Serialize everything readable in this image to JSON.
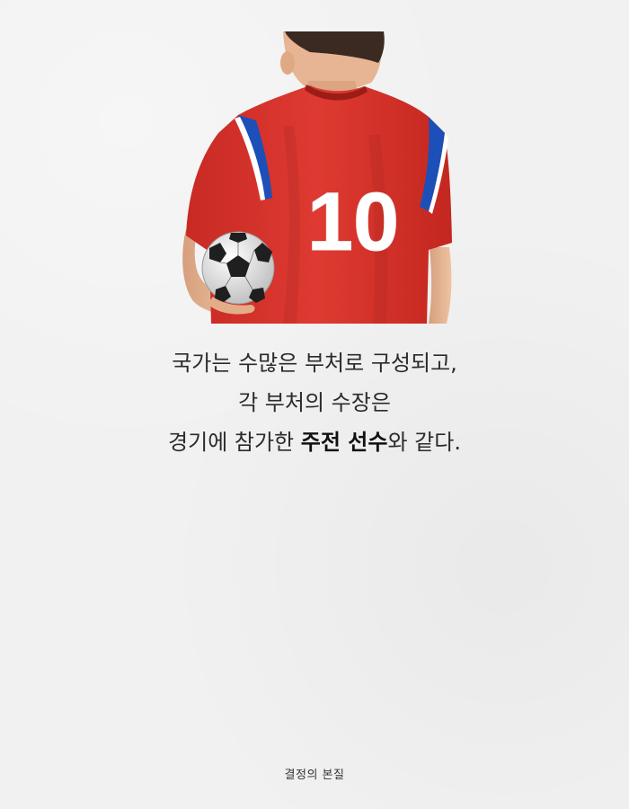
{
  "illustration": {
    "jersey_number": "10",
    "icon_name": "soccer-player-back-with-ball",
    "colors": {
      "jersey_red": "#d8342c",
      "sleeve_blue": "#1d4fb8",
      "number_white": "#ffffff",
      "skin": "#e8b693",
      "hair": "#3a2a22"
    }
  },
  "caption": {
    "line1": "국가는 수많은 부처로 구성되고,",
    "line2": "각 부처의 수장은",
    "line3_pre": "경기에 참가한 ",
    "line3_strong": "주전 선수",
    "line3_post": "와 같다."
  },
  "footer": {
    "brand": "결정의 본질"
  }
}
